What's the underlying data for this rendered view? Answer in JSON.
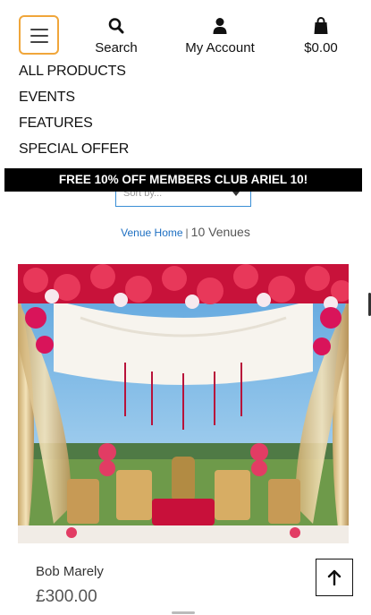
{
  "header": {
    "search_label": "Search",
    "account_label": "My Account",
    "cart_total": "$0.00",
    "icons": {
      "menu": "hamburger-icon",
      "search": "search-icon",
      "account": "user-icon",
      "cart": "shopping-bag-icon"
    },
    "menu_border_color": "#f0a63a"
  },
  "nav": {
    "items": [
      "ALL PRODUCTS",
      "EVENTS",
      "FEATURES",
      "SPECIAL OFFER"
    ]
  },
  "promo": {
    "text": "FREE 10% OFF MEMBERS CLUB ARIEL 10!"
  },
  "sort": {
    "value": "Sort by..."
  },
  "breadcrumb": {
    "home": "Venue Home",
    "separator": "|",
    "count": "10 Venues"
  },
  "product": {
    "name": "Bob Marely",
    "price": "£300.00"
  },
  "colors": {
    "link": "#1d6fc2",
    "promo_bg": "#000000",
    "sort_border": "#3a8fd6"
  }
}
